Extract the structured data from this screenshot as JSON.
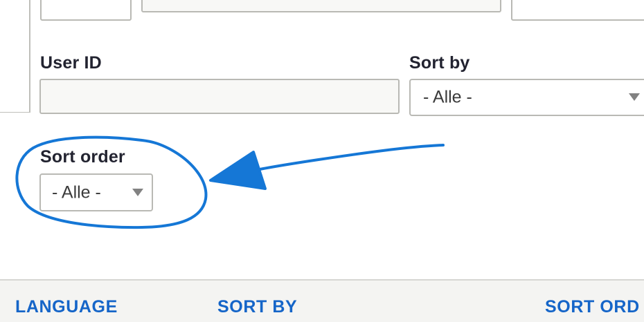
{
  "filters": {
    "user_id": {
      "label": "User ID",
      "value": ""
    },
    "sort_by": {
      "label": "Sort by",
      "selected": "- Alle -"
    },
    "sort_order": {
      "label": "Sort order",
      "selected": "- Alle -"
    }
  },
  "table_header": {
    "columns": [
      "LANGUAGE",
      "SORT BY",
      "SORT ORD"
    ]
  },
  "annotation": {
    "color": "#1577d6",
    "shapes": [
      "circle-highlight",
      "arrow"
    ]
  },
  "colors": {
    "link": "#1565c8",
    "label": "#222330",
    "border": "#b9b9b4"
  }
}
